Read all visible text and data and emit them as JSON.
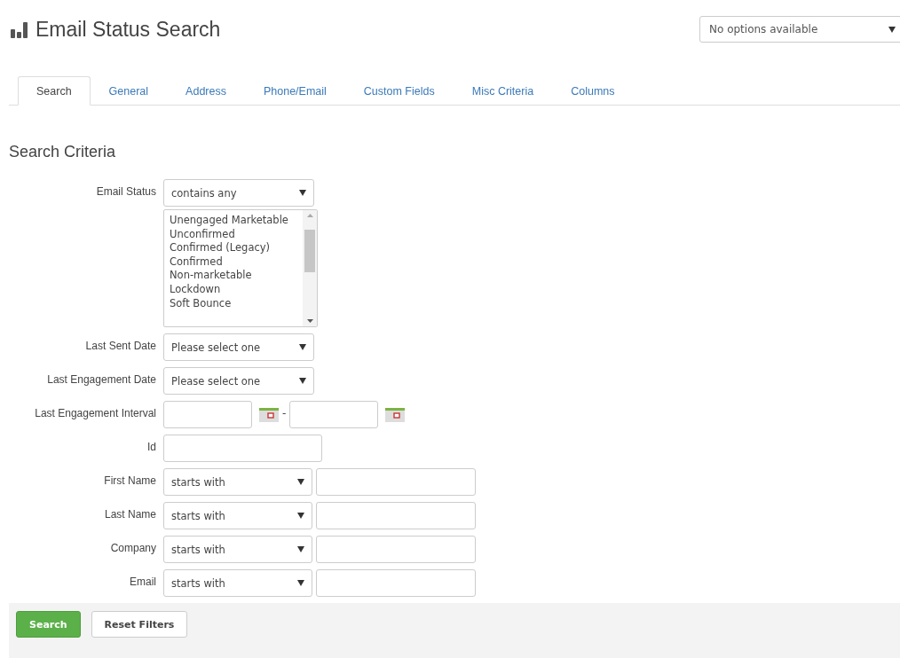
{
  "header": {
    "title": "Email Status Search",
    "options_select": {
      "value": "No options available"
    }
  },
  "tabs": [
    {
      "label": "Search",
      "selected": true
    },
    {
      "label": "General",
      "selected": false
    },
    {
      "label": "Address",
      "selected": false
    },
    {
      "label": "Phone/Email",
      "selected": false
    },
    {
      "label": "Custom Fields",
      "selected": false
    },
    {
      "label": "Misc Criteria",
      "selected": false
    },
    {
      "label": "Columns",
      "selected": false
    }
  ],
  "section_title": "Search Criteria",
  "fields": [
    {
      "kind": "select",
      "label": "Email Status",
      "value": "contains any"
    },
    {
      "kind": "listbox",
      "options": [
        "Unengaged Marketable",
        "Unconfirmed",
        "Confirmed (Legacy)",
        "Confirmed",
        "Non-marketable",
        "Lockdown",
        "Soft Bounce"
      ]
    },
    {
      "kind": "select",
      "label": "Last Sent Date",
      "value": "Please select one"
    },
    {
      "kind": "select",
      "label": "Last Engagement Date",
      "value": "Please select one"
    },
    {
      "kind": "daterange",
      "label": "Last Engagement Interval",
      "separator": "-"
    },
    {
      "kind": "text",
      "label": "Id"
    },
    {
      "kind": "selecttext",
      "label": "First Name",
      "value": "starts with"
    },
    {
      "kind": "selecttext",
      "label": "Last Name",
      "value": "starts with"
    },
    {
      "kind": "selecttext",
      "label": "Company",
      "value": "starts with"
    },
    {
      "kind": "selecttext",
      "label": "Email",
      "value": "starts with"
    }
  ],
  "buttons": [
    {
      "label": "Search",
      "kind": "primary"
    },
    {
      "label": "Reset Filters",
      "kind": "secondary"
    }
  ]
}
